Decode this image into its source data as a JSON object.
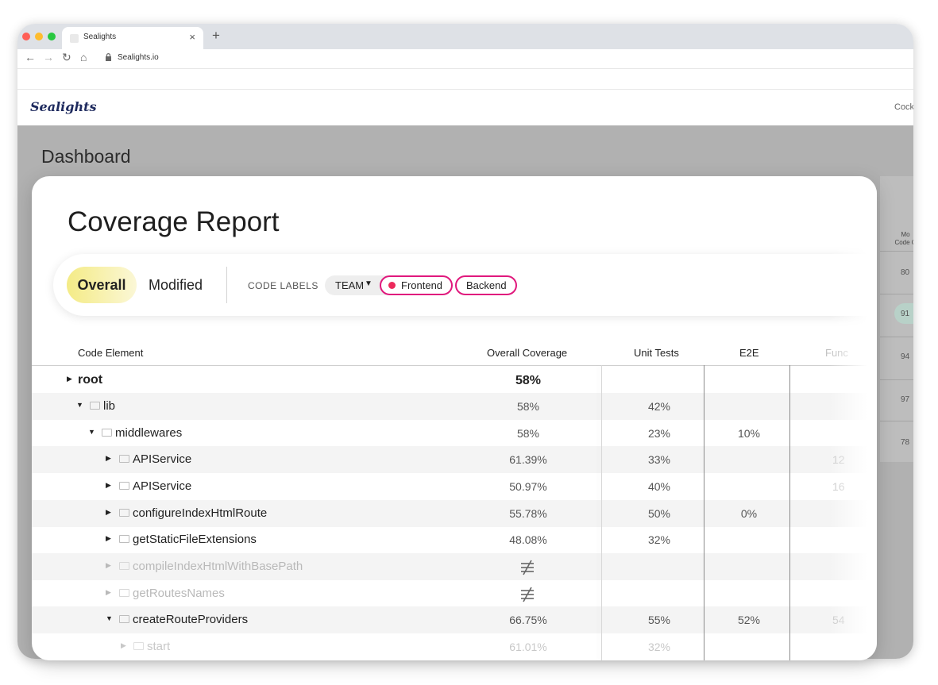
{
  "browser": {
    "tab_title": "Sealights",
    "tab_close": "×",
    "new_tab": "+",
    "url": "Sealights.io"
  },
  "app": {
    "logo": "Sealights",
    "nav_item": "Cock"
  },
  "dashboard": {
    "title": "Dashboard",
    "bg_header": [
      "Mo",
      "Code C"
    ],
    "bg_values": [
      "80",
      "91",
      "94",
      "97",
      "78"
    ]
  },
  "report": {
    "title": "Coverage Report",
    "segments": {
      "overall": "Overall",
      "modified": "Modified",
      "active": "overall"
    },
    "code_labels": "CODE LABELS",
    "team_filter": "TEAM",
    "chips": [
      {
        "label": "Frontend",
        "dot_color": "#ec2a5c"
      },
      {
        "label": "Backend"
      }
    ],
    "accent_color": "#e0197d",
    "columns": [
      "Code Element",
      "Overall Coverage",
      "Unit Tests",
      "E2E",
      "Func"
    ],
    "rows": [
      {
        "name": "root",
        "overall": "58%",
        "unit": "",
        "e2e": "",
        "func": ""
      },
      {
        "name": "lib",
        "overall": "58%",
        "unit": "42%",
        "e2e": "",
        "func": ""
      },
      {
        "name": "middlewares",
        "overall": "58%",
        "unit": "23%",
        "e2e": "10%",
        "func": ""
      },
      {
        "name": "APIService",
        "overall": "61.39%",
        "unit": "33%",
        "e2e": "",
        "func": "12"
      },
      {
        "name": "APIService",
        "overall": "50.97%",
        "unit": "40%",
        "e2e": "",
        "func": "16"
      },
      {
        "name": "configureIndexHtmlRoute",
        "overall": "55.78%",
        "unit": "50%",
        "e2e": "0%",
        "func": ""
      },
      {
        "name": "getStaticFileExtensions",
        "overall": "48.08%",
        "unit": "32%",
        "e2e": "",
        "func": ""
      },
      {
        "name": "compileIndexHtmlWithBasePath",
        "overall": "",
        "unit": "",
        "e2e": "",
        "func": ""
      },
      {
        "name": "getRoutesNames",
        "overall": "",
        "unit": "",
        "e2e": "",
        "func": ""
      },
      {
        "name": "createRouteProviders",
        "overall": "66.75%",
        "unit": "55%",
        "e2e": "52%",
        "func": "54"
      },
      {
        "name": "start",
        "overall": "61.01%",
        "unit": "32%",
        "e2e": "",
        "func": ""
      }
    ]
  }
}
